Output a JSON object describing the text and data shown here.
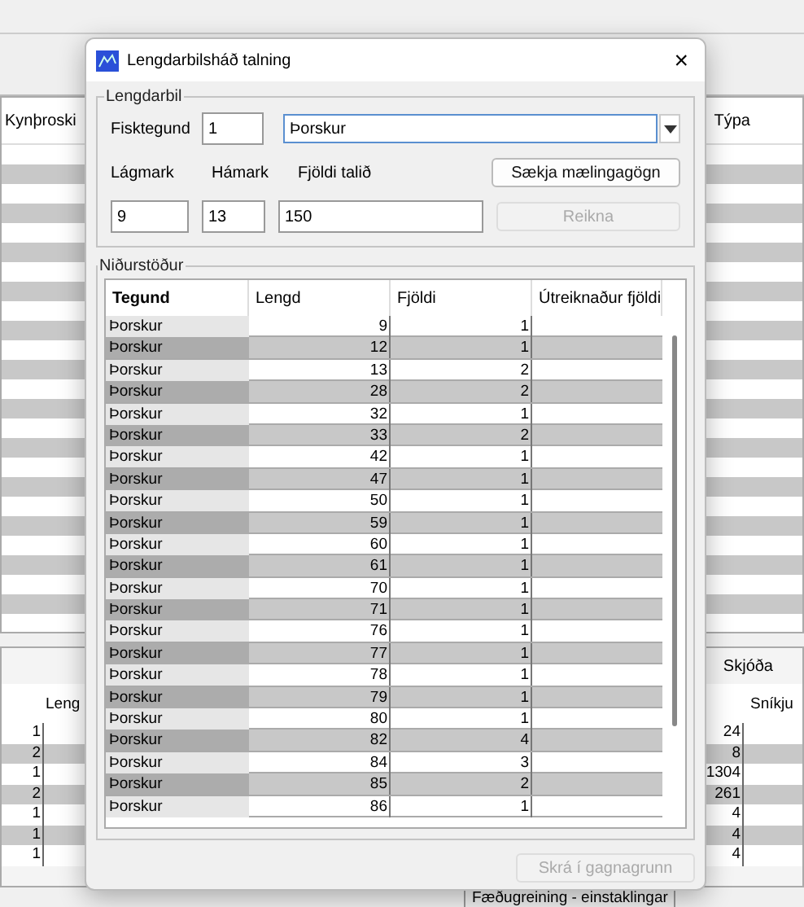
{
  "background": {
    "left_header": "Kynþroski",
    "right_header": "Týpa",
    "lower_left": {
      "header": "Leng",
      "values": [
        "1",
        "2",
        "1",
        "2",
        "1",
        "1",
        "1"
      ]
    },
    "lower_right": {
      "tab": "Skjóða",
      "header": "Sníkju",
      "values": [
        "24",
        "8",
        "1304",
        "261",
        "4",
        "4",
        "4"
      ]
    },
    "bottom_tab": "Fæðugreining - einstaklingar"
  },
  "dialog": {
    "title": "Lengdarbilsháð talning",
    "close": "×",
    "range_group": {
      "title": "Lengdarbil",
      "species_label": "Fisktegund",
      "species_code": "1",
      "species_name": "Þorskur",
      "min_label": "Lágmark",
      "max_label": "Hámark",
      "count_label": "Fjöldi talið",
      "min": "9",
      "max": "13",
      "count": "150",
      "fetch_button": {
        "label": "Sækja mælingagögn",
        "disabled": false
      },
      "calc_button": {
        "label": "Reikna",
        "disabled": true
      }
    },
    "results_group": {
      "title": "Niðurstöður",
      "columns": [
        "Tegund",
        "Lengd",
        "Fjöldi",
        "Útreiknaður fjöldi"
      ],
      "rows": [
        [
          "Þorskur",
          "9",
          "1",
          ""
        ],
        [
          "Þorskur",
          "12",
          "1",
          ""
        ],
        [
          "Þorskur",
          "13",
          "2",
          ""
        ],
        [
          "Þorskur",
          "28",
          "2",
          ""
        ],
        [
          "Þorskur",
          "32",
          "1",
          ""
        ],
        [
          "Þorskur",
          "33",
          "2",
          ""
        ],
        [
          "Þorskur",
          "42",
          "1",
          ""
        ],
        [
          "Þorskur",
          "47",
          "1",
          ""
        ],
        [
          "Þorskur",
          "50",
          "1",
          ""
        ],
        [
          "Þorskur",
          "59",
          "1",
          ""
        ],
        [
          "Þorskur",
          "60",
          "1",
          ""
        ],
        [
          "Þorskur",
          "61",
          "1",
          ""
        ],
        [
          "Þorskur",
          "70",
          "1",
          ""
        ],
        [
          "Þorskur",
          "71",
          "1",
          ""
        ],
        [
          "Þorskur",
          "76",
          "1",
          ""
        ],
        [
          "Þorskur",
          "77",
          "1",
          ""
        ],
        [
          "Þorskur",
          "78",
          "1",
          ""
        ],
        [
          "Þorskur",
          "79",
          "1",
          ""
        ],
        [
          "Þorskur",
          "80",
          "1",
          ""
        ],
        [
          "Þorskur",
          "82",
          "4",
          ""
        ],
        [
          "Þorskur",
          "84",
          "3",
          ""
        ],
        [
          "Þorskur",
          "85",
          "2",
          ""
        ],
        [
          "Þorskur",
          "86",
          "1",
          ""
        ]
      ]
    },
    "save_button": {
      "label": "Skrá í gagnagrunn",
      "disabled": true
    }
  }
}
